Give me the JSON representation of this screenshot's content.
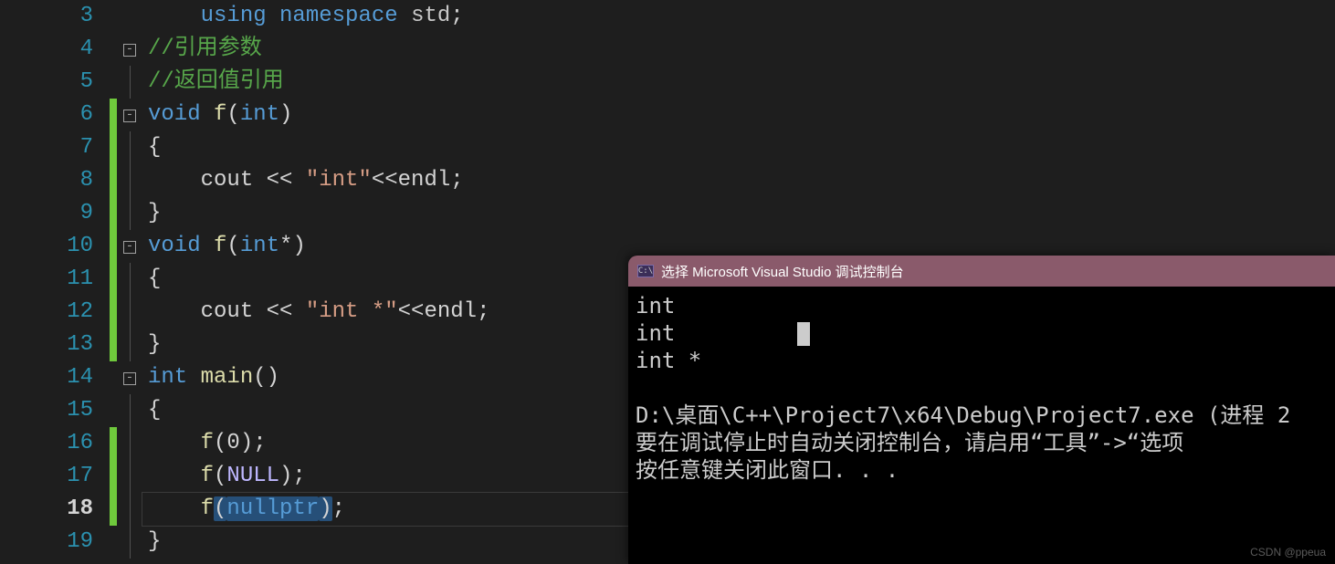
{
  "editor": {
    "lines": [
      {
        "num": 3,
        "changed": false,
        "fold": "",
        "tokens": [
          [
            "    ",
            ""
          ],
          [
            "using",
            "kw"
          ],
          [
            " ",
            ""
          ],
          [
            "namespace",
            "kw"
          ],
          [
            " ",
            ""
          ],
          [
            "std",
            "nsname"
          ],
          [
            ";",
            "punct"
          ]
        ]
      },
      {
        "num": 4,
        "changed": false,
        "fold": "box",
        "tokens": [
          [
            "//引用参数",
            "comment"
          ]
        ]
      },
      {
        "num": 5,
        "changed": false,
        "fold": "line",
        "tokens": [
          [
            "//返回值引用",
            "comment"
          ]
        ]
      },
      {
        "num": 6,
        "changed": true,
        "fold": "box",
        "tokens": [
          [
            "void",
            "type"
          ],
          [
            " ",
            ""
          ],
          [
            "f",
            "func"
          ],
          [
            "(",
            "punct"
          ],
          [
            "int",
            "type"
          ],
          [
            ")",
            "punct"
          ]
        ]
      },
      {
        "num": 7,
        "changed": true,
        "fold": "line",
        "tokens": [
          [
            "{",
            "punct"
          ]
        ]
      },
      {
        "num": 8,
        "changed": true,
        "fold": "line",
        "tokens": [
          [
            "    ",
            ""
          ],
          [
            "cout",
            "ident"
          ],
          [
            " << ",
            "punct"
          ],
          [
            "\"int\"",
            "str"
          ],
          [
            "<<",
            "punct"
          ],
          [
            "endl",
            "ident"
          ],
          [
            ";",
            "punct"
          ]
        ]
      },
      {
        "num": 9,
        "changed": true,
        "fold": "line",
        "tokens": [
          [
            "}",
            "punct"
          ]
        ]
      },
      {
        "num": 10,
        "changed": true,
        "fold": "box",
        "tokens": [
          [
            "void",
            "type"
          ],
          [
            " ",
            ""
          ],
          [
            "f",
            "func"
          ],
          [
            "(",
            "punct"
          ],
          [
            "int",
            "type"
          ],
          [
            "*)",
            "punct"
          ]
        ]
      },
      {
        "num": 11,
        "changed": true,
        "fold": "line",
        "tokens": [
          [
            "{",
            "punct"
          ]
        ]
      },
      {
        "num": 12,
        "changed": true,
        "fold": "line",
        "tokens": [
          [
            "    ",
            ""
          ],
          [
            "cout",
            "ident"
          ],
          [
            " << ",
            "punct"
          ],
          [
            "\"int *\"",
            "str"
          ],
          [
            "<<",
            "punct"
          ],
          [
            "endl",
            "ident"
          ],
          [
            ";",
            "punct"
          ]
        ]
      },
      {
        "num": 13,
        "changed": true,
        "fold": "line",
        "tokens": [
          [
            "}",
            "punct"
          ]
        ]
      },
      {
        "num": 14,
        "changed": false,
        "fold": "box",
        "tokens": [
          [
            "int",
            "type"
          ],
          [
            " ",
            ""
          ],
          [
            "main",
            "func"
          ],
          [
            "()",
            "punct"
          ]
        ]
      },
      {
        "num": 15,
        "changed": false,
        "fold": "line",
        "tokens": [
          [
            "{",
            "punct"
          ]
        ]
      },
      {
        "num": 16,
        "changed": true,
        "fold": "line",
        "tokens": [
          [
            "    ",
            ""
          ],
          [
            "f",
            "func"
          ],
          [
            "(",
            "punct"
          ],
          [
            "0",
            "num"
          ],
          [
            ");",
            "punct"
          ]
        ]
      },
      {
        "num": 17,
        "changed": true,
        "fold": "line",
        "tokens": [
          [
            "    ",
            ""
          ],
          [
            "f",
            "func"
          ],
          [
            "(",
            "punct"
          ],
          [
            "NULL",
            "macro"
          ],
          [
            ");",
            "punct"
          ]
        ]
      },
      {
        "num": 18,
        "changed": true,
        "fold": "line",
        "current": true,
        "tokens": [
          [
            "    ",
            ""
          ],
          [
            "f",
            "func"
          ],
          [
            "(",
            "punct hl"
          ],
          [
            "nullptr",
            "nullk hl"
          ],
          [
            ")",
            "punct hl"
          ],
          [
            ";",
            "punct"
          ]
        ]
      },
      {
        "num": 19,
        "changed": false,
        "fold": "line",
        "tokens": [
          [
            "}",
            "punct"
          ]
        ]
      }
    ]
  },
  "console": {
    "icon_label": "C:\\",
    "title": "选择 Microsoft Visual Studio 调试控制台",
    "output": [
      "int",
      "int",
      "int *",
      "",
      "D:\\桌面\\C++\\Project7\\x64\\Debug\\Project7.exe (进程 2",
      "要在调试停止时自动关闭控制台，请启用“工具”->“选项",
      "按任意键关闭此窗口. . ."
    ],
    "cursor_line": 1
  },
  "watermark": "CSDN @ppeua"
}
